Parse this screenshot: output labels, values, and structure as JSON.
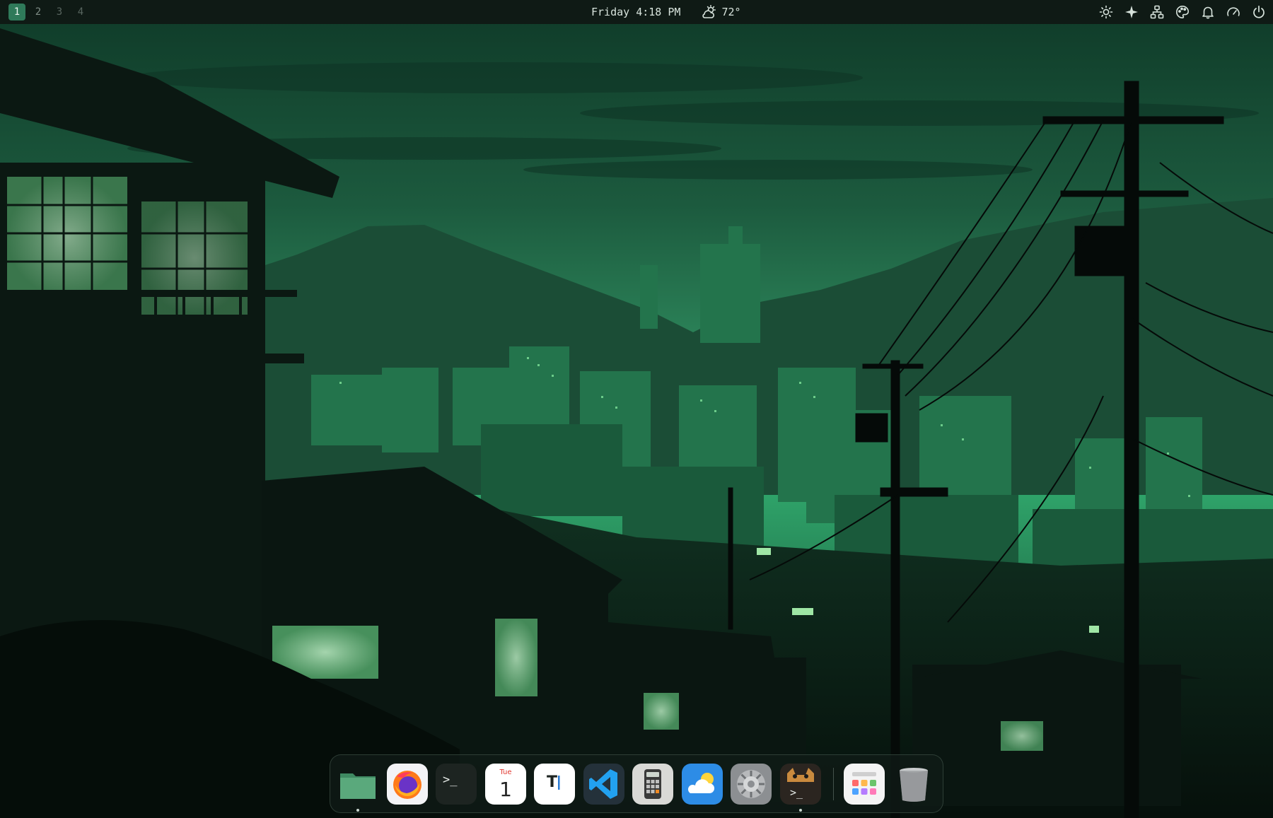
{
  "topbar": {
    "workspaces": [
      {
        "label": "1",
        "active": true
      },
      {
        "label": "2",
        "active": false
      },
      {
        "label": "3",
        "active": false
      },
      {
        "label": "4",
        "active": false
      }
    ],
    "clock": "Friday 4:18 PM",
    "weather": {
      "icon": "partly-sunny-icon",
      "temp": "72°"
    },
    "tray": [
      "brightness-icon",
      "sparkle-icon",
      "network-icon",
      "palette-icon",
      "bell-icon",
      "speedometer-icon",
      "power-icon"
    ]
  },
  "dock": {
    "apps": [
      {
        "name": "files",
        "icon": "folder-icon",
        "running": true
      },
      {
        "name": "firefox",
        "icon": "firefox-icon",
        "running": false
      },
      {
        "name": "terminal",
        "icon": "terminal-icon",
        "label": ">_",
        "running": false
      },
      {
        "name": "calendar",
        "icon": "calendar-icon",
        "day": "Tue",
        "date": "1",
        "running": false
      },
      {
        "name": "text-editor",
        "icon": "text-editor-icon",
        "label": "T",
        "running": false
      },
      {
        "name": "vscode",
        "icon": "vscode-icon",
        "running": false
      },
      {
        "name": "calculator",
        "icon": "calculator-icon",
        "running": false
      },
      {
        "name": "weather",
        "icon": "weather-icon",
        "running": false
      },
      {
        "name": "settings",
        "icon": "settings-gear-icon",
        "running": false
      },
      {
        "name": "terminal-cat",
        "icon": "cat-terminal-icon",
        "label": ">_",
        "running": true
      }
    ],
    "pinned_right": [
      {
        "name": "app-launcher",
        "icon": "app-grid-icon"
      },
      {
        "name": "trash",
        "icon": "trash-icon"
      }
    ]
  },
  "colors": {
    "accent": "#2f7a5a",
    "bar_bg": "#0f1a15",
    "sky": "#2f9a67"
  }
}
